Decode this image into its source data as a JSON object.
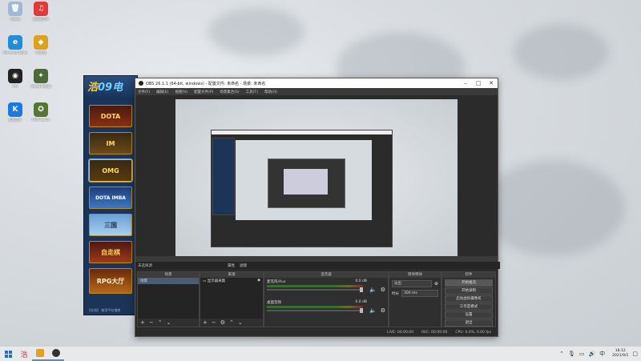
{
  "desktop_icons": [
    {
      "label": "回收站",
      "icon": "recycle-bin-icon",
      "color": "#9fb8d8",
      "glyph": "🗑"
    },
    {
      "label": "网易云音乐",
      "icon": "netease-music-icon",
      "color": "#e03a3a",
      "glyph": "♫"
    },
    {
      "label": "Microsoft Edge",
      "icon": "edge-icon",
      "color": "#1e8fd8",
      "glyph": "e"
    },
    {
      "label": "09游戏",
      "icon": "game-platform-icon",
      "color": "#e0a020",
      "glyph": "◆"
    },
    {
      "label": "QQ",
      "icon": "qq-icon",
      "color": "#222222",
      "glyph": "◉"
    },
    {
      "label": "Dota2 启动器",
      "icon": "dota-launcher-icon",
      "color": "#4a6a3a",
      "glyph": "✦"
    },
    {
      "label": "酷狗音乐",
      "icon": "kugou-icon",
      "color": "#1a7ae0",
      "glyph": "K"
    },
    {
      "label": "OBS Studio",
      "icon": "obs-desktop-icon",
      "color": "#557733",
      "glyph": "✪"
    }
  ],
  "launcher": {
    "logo_main": "浩",
    "logo_accent": "09电",
    "games": [
      {
        "label": "DOTA",
        "cls": "dota"
      },
      {
        "label": "IM",
        "cls": "im"
      },
      {
        "label": "OMG",
        "cls": "omg"
      },
      {
        "label": "DOTA IMBA",
        "cls": "dota2"
      },
      {
        "label": "三国",
        "cls": "san"
      },
      {
        "label": "自走棋",
        "cls": "zz"
      },
      {
        "label": "RPG大厅",
        "cls": "rpg"
      }
    ],
    "footer": "【在线】 使用平台指南"
  },
  "obs": {
    "title": "OBS 26.1.1 (64-bit, windows) - 配置文件: 未命名 - 场景: 未命名",
    "menu": [
      "文件(F)",
      "编辑(E)",
      "视图(V)",
      "配置文件(P)",
      "场景集合(S)",
      "工具(T)",
      "帮助(H)"
    ],
    "scene_bar_label": "未选择源",
    "scene_tabs": [
      "属性",
      "滤镜"
    ],
    "docks": {
      "scenes": {
        "header": "场景",
        "items": [
          "场景"
        ]
      },
      "sources": {
        "header": "来源",
        "items": [
          "显示器采集"
        ]
      },
      "mixer": {
        "header": "混音器",
        "channels": [
          {
            "name": "麦克风/Aux",
            "db": "0.0 dB"
          },
          {
            "name": "桌面音频",
            "db": "0.0 dB"
          }
        ]
      },
      "transitions": {
        "header": "转场特效",
        "type": "淡出",
        "duration_label": "时长",
        "duration": "300 ms"
      },
      "controls": {
        "header": "控件",
        "buttons": [
          "开始推流",
          "开始录制",
          "启动虚拟摄像机",
          "工作室模式",
          "设置",
          "退出"
        ]
      }
    },
    "status": {
      "live": "LIVE: 00:00:00",
      "rec": "REC: 00:00:00",
      "cpu": "CPU: 0.0%, 0.00 fps"
    }
  },
  "taskbar": {
    "time": "18:12",
    "date": "2021/9/1",
    "ime": "中"
  }
}
